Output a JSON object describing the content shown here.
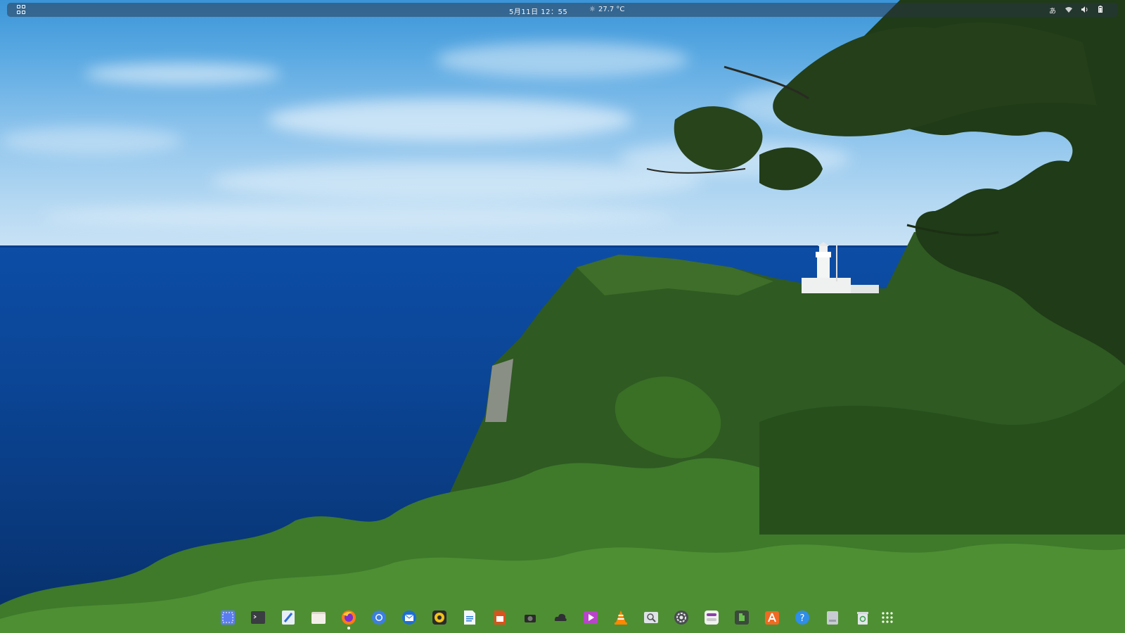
{
  "top_panel": {
    "clock": "5月11日  12：55",
    "weather": {
      "icon": "sun-icon",
      "temperature": "27.7 °C"
    },
    "tray": {
      "input_method": "あ",
      "network_icon": "wifi-icon",
      "volume_icon": "volume-icon",
      "battery_icon": "battery-icon"
    }
  },
  "dock": {
    "items": [
      {
        "name": "screenshot",
        "icon": "screenshot-icon",
        "color": "#5b7df0"
      },
      {
        "name": "terminal",
        "icon": "terminal-icon",
        "color": "#3a3d42"
      },
      {
        "name": "text-editor",
        "icon": "text-editor-icon",
        "color": "#e8eef8"
      },
      {
        "name": "files",
        "icon": "folder-icon",
        "color": "#ddd7cc"
      },
      {
        "name": "firefox",
        "icon": "firefox-icon",
        "color": "#ff7a18",
        "running": true
      },
      {
        "name": "chromium",
        "icon": "chromium-icon",
        "color": "#3c7fe0"
      },
      {
        "name": "thunderbird",
        "icon": "mail-icon",
        "color": "#1e6fd6"
      },
      {
        "name": "rhythmbox",
        "icon": "music-icon",
        "color": "#f2c21a"
      },
      {
        "name": "writer",
        "icon": "document-icon",
        "color": "#2a7ed6"
      },
      {
        "name": "impress",
        "icon": "presentation-icon",
        "color": "#d9531e"
      },
      {
        "name": "camera",
        "icon": "camera-icon",
        "color": "#2b2b2b"
      },
      {
        "name": "cloud-app",
        "icon": "cloud-icon",
        "color": "#2f2f35"
      },
      {
        "name": "video-player",
        "icon": "video-icon",
        "color": "#b845c9"
      },
      {
        "name": "vlc",
        "icon": "vlc-icon",
        "color": "#ff8800"
      },
      {
        "name": "image-viewer",
        "icon": "image-viewer-icon",
        "color": "#dfe3e8"
      },
      {
        "name": "settings",
        "icon": "settings-icon",
        "color": "#4a4d52"
      },
      {
        "name": "tweaks",
        "icon": "tweaks-icon",
        "color": "#8b3fa8"
      },
      {
        "name": "extensions",
        "icon": "extensions-icon",
        "color": "#3b4a3c"
      },
      {
        "name": "software",
        "icon": "software-icon",
        "color": "#ef6a22"
      },
      {
        "name": "help",
        "icon": "help-icon",
        "color": "#2f8ee8"
      },
      {
        "name": "disk",
        "icon": "disk-icon",
        "color": "#c8ccd2"
      },
      {
        "name": "trash",
        "icon": "trash-icon",
        "color": "#d5d9de"
      },
      {
        "name": "show-applications",
        "icon": "app-grid-icon",
        "color": "#ffffff"
      }
    ]
  }
}
